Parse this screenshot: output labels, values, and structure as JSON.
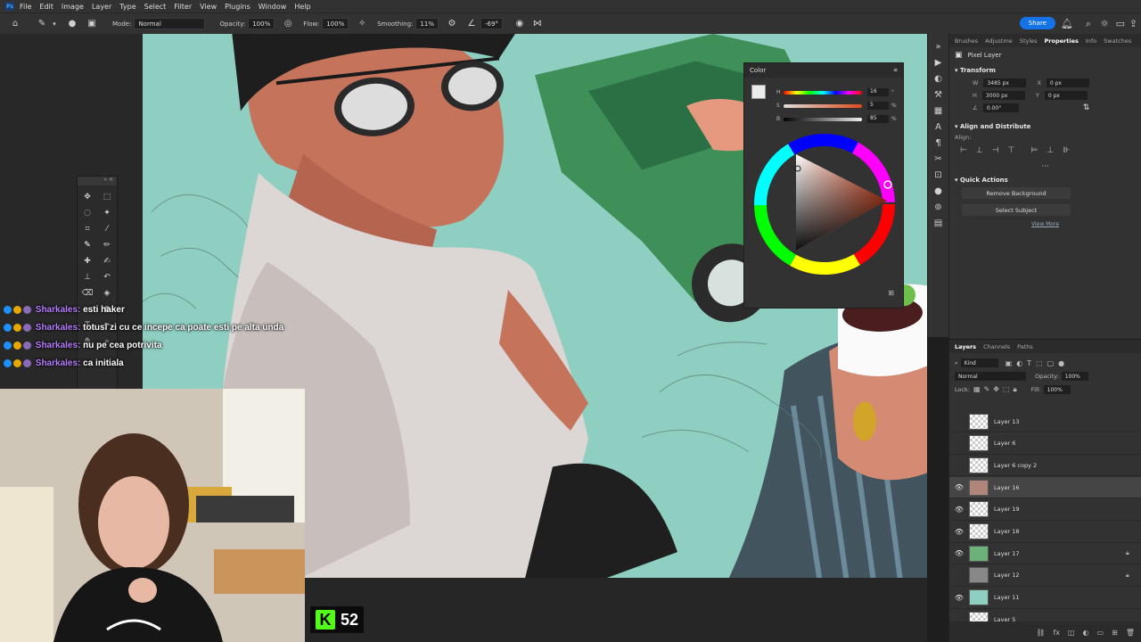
{
  "menubar": {
    "logo": "Ps",
    "items": [
      "File",
      "Edit",
      "Image",
      "Layer",
      "Type",
      "Select",
      "Filter",
      "View",
      "Plugins",
      "Window",
      "Help"
    ]
  },
  "options_bar": {
    "mode_label": "Mode:",
    "mode_value": "Normal",
    "opacity_label": "Opacity:",
    "opacity_value": "100%",
    "flow_label": "Flow:",
    "flow_value": "100%",
    "smoothing_label": "Smoothing:",
    "smoothing_value": "11%",
    "angle_value": "-69°",
    "share_label": "Share"
  },
  "chat": {
    "messages": [
      {
        "user": "Sharkales:",
        "text": "esti haker"
      },
      {
        "user": "Sharkales:",
        "text": "totusi zi cu ce incepe ca poate esti pe alta unda"
      },
      {
        "user": "Sharkales:",
        "text": "nu pe cea potrivita"
      },
      {
        "user": "Sharkales:",
        "text": "ca initiala"
      }
    ]
  },
  "kick": {
    "viewer_count": "52",
    "logo_letter": "K"
  },
  "color_panel": {
    "title": "Color",
    "h_label": "H",
    "h_value": "16",
    "h_unit": "°",
    "s_label": "S",
    "s_value": "5",
    "s_unit": "%",
    "b_label": "B",
    "b_value": "85",
    "b_unit": "%"
  },
  "properties": {
    "tabs": [
      "Brushes",
      "Adjustme",
      "Styles",
      "Properties",
      "Info",
      "Swatches"
    ],
    "active_tab": "Properties",
    "layer_type": "Pixel Layer",
    "transform_title": "Transform",
    "w_label": "W",
    "w_value": "3485 px",
    "h_label": "H",
    "h_value": "3000 px",
    "x_label": "X",
    "x_value": "0 px",
    "y_label": "Y",
    "y_value": "0 px",
    "angle_value": "0.00°",
    "align_title": "Align and Distribute",
    "align_label": "Align:",
    "quick_actions_title": "Quick Actions",
    "remove_bg_label": "Remove Background",
    "select_subject_label": "Select Subject",
    "view_more_label": "View More"
  },
  "layers_panel": {
    "tabs": [
      "Layers",
      "Channels",
      "Paths"
    ],
    "active_tab": "Layers",
    "filter_label": "Kind",
    "blend_mode": "Normal",
    "opacity_label": "Opacity:",
    "opacity_value": "100%",
    "lock_label": "Lock:",
    "fill_label": "Fill:",
    "fill_value": "100%",
    "layers": [
      {
        "name": "Layer 13",
        "visible": false,
        "locked": false,
        "active": false,
        "thumb": "transparent"
      },
      {
        "name": "Layer 6",
        "visible": false,
        "locked": false,
        "active": false,
        "thumb": "transparent"
      },
      {
        "name": "Layer 6 copy 2",
        "visible": false,
        "locked": false,
        "active": false,
        "thumb": "transparent"
      },
      {
        "name": "Layer 16",
        "visible": true,
        "locked": false,
        "active": true,
        "thumb": "art"
      },
      {
        "name": "Layer 19",
        "visible": true,
        "locked": false,
        "active": false,
        "thumb": "transparent"
      },
      {
        "name": "Layer 18",
        "visible": true,
        "locked": false,
        "active": false,
        "thumb": "transparent"
      },
      {
        "name": "Layer 17",
        "visible": true,
        "locked": true,
        "active": false,
        "thumb": "green"
      },
      {
        "name": "Layer 12",
        "visible": false,
        "locked": true,
        "active": false,
        "thumb": "dark"
      },
      {
        "name": "Layer 11",
        "visible": true,
        "locked": false,
        "active": false,
        "thumb": "teal"
      },
      {
        "name": "Layer 5",
        "visible": false,
        "locked": false,
        "active": false,
        "thumb": "transparent"
      }
    ]
  },
  "colors": {
    "accent": "#1473e6",
    "canvas_bg": "#8fcfc2",
    "chat_user": "#b67dff",
    "kick_green": "#53fc18"
  }
}
